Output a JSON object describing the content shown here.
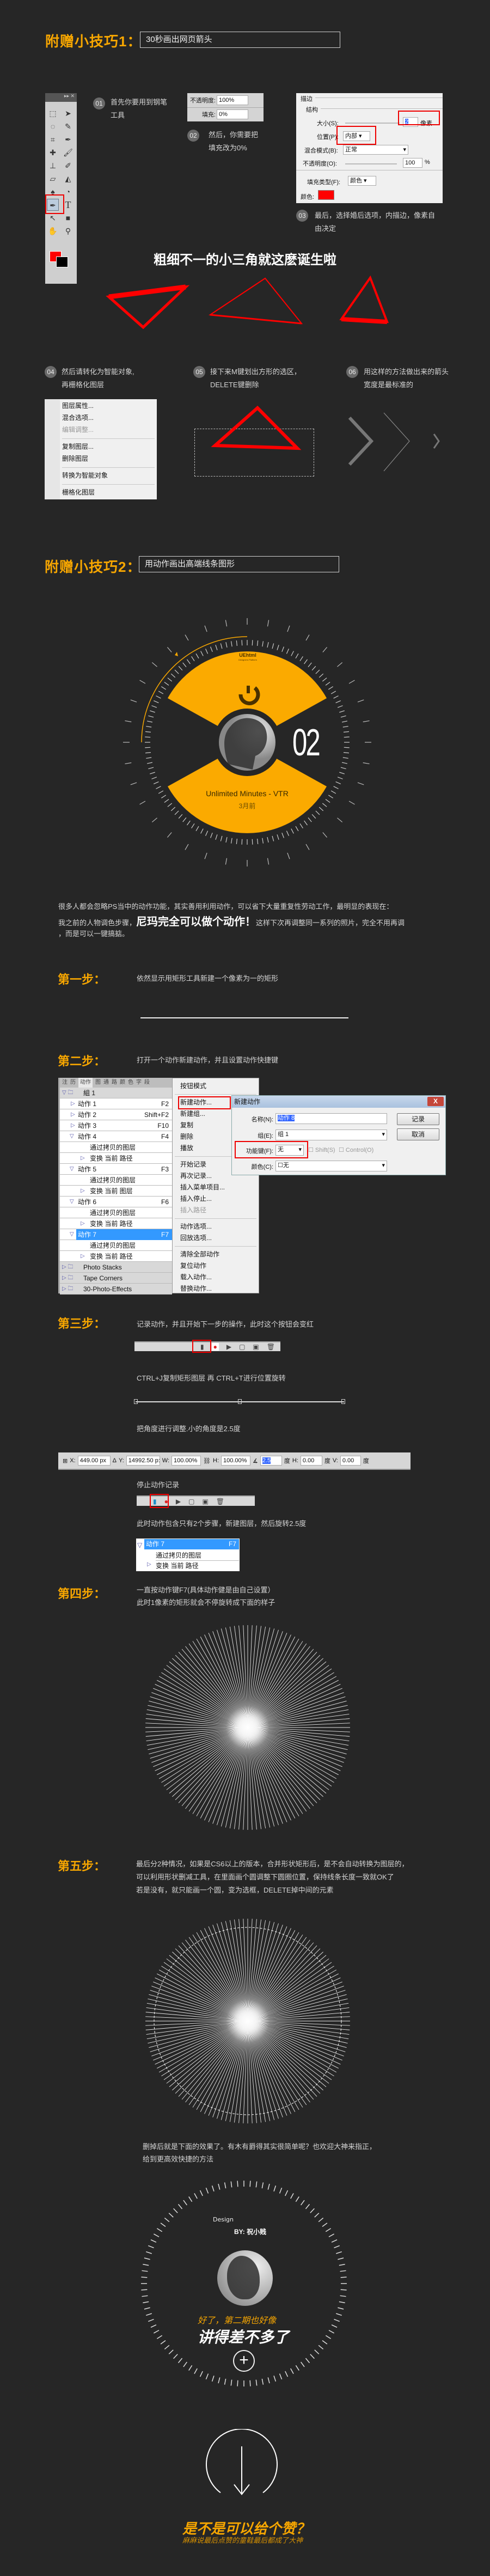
{
  "tip1": {
    "label": "附赠小技巧1：",
    "title": "30秒画出网页箭头"
  },
  "steps_a": [
    {
      "num": "01",
      "line1": "首先你要用到钢笔",
      "line2": "工具"
    },
    {
      "num": "02",
      "line1": "然后，你需要把",
      "line2": "填充改为0%"
    },
    {
      "num": "03",
      "line1": "最后，选择婚后选项，内描边，像素自",
      "line2": "由决定"
    }
  ],
  "fill_panel": {
    "opacity_label": "不透明度:",
    "opacity_value": "100%",
    "fill_label": "填充:",
    "fill_value": "0%"
  },
  "stroke_panel": {
    "title": "描边",
    "structure": "结构",
    "size_label": "大小(S):",
    "size_value": "2",
    "size_unit": "像素",
    "position_label": "位置(P):",
    "position_value": "内部",
    "blend_label": "混合模式(B):",
    "blend_value": "正常",
    "opacity_label": "不透明度(O):",
    "opacity_value": "100",
    "opacity_unit": "%",
    "fill_type_label": "填充类型(F):",
    "fill_type_value": "颜色",
    "color_label": "颜色:",
    "color_value": "#ff0000"
  },
  "heading1": "粗细不一的小三角就这麽诞生啦",
  "steps_b": [
    {
      "num": "04",
      "line1": "然后请转化为智能对象,",
      "line2": "再栅格化图层"
    },
    {
      "num": "05",
      "line1": "接下来M键划出方形的选区，",
      "line2": "DELETE键删除"
    },
    {
      "num": "06",
      "line1": "用这样的方法做出来的箭头",
      "line2": "宽度是最标准的"
    }
  ],
  "layer_menu": {
    "items": [
      "图层属性...",
      "混合选项...",
      "编辑调整...",
      "复制图层...",
      "删除图层",
      "转换为智能对象",
      "栅格化图层"
    ]
  },
  "tip2": {
    "label": "附赠小技巧2：",
    "title": "用动作画出高端线条图形"
  },
  "card": {
    "logo": "UEhtml",
    "logo_sub": "Designers Platform",
    "number": "02",
    "title": "Unlimited Minutes  - VTR",
    "time": "3月前",
    "accent": "#fbaa00"
  },
  "intro": {
    "line1": "很多人都会忽略PS当中的动作功能，其实善用利用动作，可以省下大量重复性劳动工作，最明显的表现在：",
    "line2a": "我之前的人物调色步骤，",
    "line2b": "尼玛完全可以做个动作！",
    "line2c": "这样下次再调整同一系列的照片，完全不用再调",
    "line3": "，而是可以一键搞掂。"
  },
  "step1": {
    "label": "第一步：",
    "text": "依然显示用矩形工具新建一个像素为一的矩形"
  },
  "step2": {
    "label": "第二步：",
    "text": "打开一个动作新建动作，并且设置动作快捷键"
  },
  "actions_panel": {
    "tabs": [
      "注",
      "历",
      "动作",
      "图",
      "通",
      "路",
      "颜",
      "色",
      "字",
      "段"
    ],
    "rows": [
      {
        "label": "組 1",
        "key": "",
        "type": "group-open"
      },
      {
        "label": "动作 1",
        "key": "F2",
        "type": "action"
      },
      {
        "label": "动作 2",
        "key": "Shift+F2",
        "type": "action"
      },
      {
        "label": "动作 3",
        "key": "F10",
        "type": "action"
      },
      {
        "label": "动作 4",
        "key": "F4",
        "type": "action-open"
      },
      {
        "label": "通过拷贝的图层",
        "key": "",
        "type": "cmd"
      },
      {
        "label": "变换 当前 路径",
        "key": "",
        "type": "cmd-arrow"
      },
      {
        "label": "动作 5",
        "key": "F3",
        "type": "action-open"
      },
      {
        "label": "通过拷贝的图层",
        "key": "",
        "type": "cmd"
      },
      {
        "label": "变换 当前 图层",
        "key": "",
        "type": "cmd-arrow"
      },
      {
        "label": "动作 6",
        "key": "F6",
        "type": "action-open"
      },
      {
        "label": "通过拷贝的图层",
        "key": "",
        "type": "cmd"
      },
      {
        "label": "变换 当前 路径",
        "key": "",
        "type": "cmd-arrow"
      },
      {
        "label": "动作 7",
        "key": "F7",
        "type": "action-selected"
      },
      {
        "label": "通过拷贝的图层",
        "key": "",
        "type": "cmd"
      },
      {
        "label": "变换 当前 路径",
        "key": "",
        "type": "cmd-arrow"
      },
      {
        "label": "Photo Stacks",
        "key": "",
        "type": "group"
      },
      {
        "label": "Tape Corners",
        "key": "",
        "type": "group"
      },
      {
        "label": "30-Photo-Effects",
        "key": "",
        "type": "group"
      }
    ]
  },
  "flyout": {
    "groups": [
      [
        "按钮模式"
      ],
      [
        "新建动作...",
        "新建组...",
        "复制",
        "删除",
        "播放"
      ],
      [
        "开始记录",
        "再次记录...",
        "插入菜单项目...",
        "插入停止...",
        "插入路径"
      ],
      [
        "动作选项...",
        "回放选项..."
      ],
      [
        "清除全部动作",
        "复位动作",
        "载入动作...",
        "替换动作..."
      ]
    ]
  },
  "dialog": {
    "title": "新建动作",
    "close": "X",
    "name_label": "名称(N):",
    "name_value": "动作 8",
    "group_label": "组(E):",
    "group_value": "组 1",
    "fkey_label": "功能键(F):",
    "fkey_value": "无",
    "shift_label": "Shift(S)",
    "control_label": "Control(O)",
    "color_label": "颜色(C):",
    "color_value": "无",
    "record": "记录",
    "cancel": "取消"
  },
  "step3": {
    "label": "第三步：",
    "text1": "记录动作，并且开始下一步的操作，此时这个按钮会变红",
    "text2": "CTRL+J复制矩形图层    再 CTRL+T进行位置旋转",
    "text3": "把角度进行调整.小的角度是2.5度",
    "text4": "停止动作记录",
    "text5": "此时动作包含只有2个步骤，新建图层，然后旋转2.5度"
  },
  "options_bar": {
    "x_label": "X:",
    "x_value": "449.00 px",
    "y_label": "Y:",
    "y_value": "14992.50 p:",
    "w_label": "W:",
    "w_value": "100.00%",
    "h_label": "H:",
    "h_value": "100.00%",
    "angle_value": "2.5",
    "deg": "度",
    "hskew_label": "H:",
    "hskew_value": "0.00",
    "vskew_label": "V:",
    "vskew_value": "0.00"
  },
  "mini_panel": {
    "action": "动作 7",
    "key": "F7",
    "cmd1": "通过拷贝的图层",
    "cmd2": "变换 当前 路径"
  },
  "step4": {
    "label": "第四步：",
    "text1": "一直按动作键F7(具体动作健是由自己设置）",
    "text2": "此时1像素的矩形就会不停旋转成下面的样子"
  },
  "step5": {
    "label": "第五步：",
    "text1": "最后分2种情况，如果是CS6以上的版本，合并形状矩形后，是不会自动转换为图层的，",
    "text2": "可以利用形状删减工具，在里面画个圆调整下圆圈位置，保持线条长度一致就OK了",
    "text3": "若是没有，就只能画一个圆，变为选框，DELETE掉中间的元素"
  },
  "outro": {
    "text1": "删掉后就是下面的效果了。有木有爵得其实很简单呢？也欢迎大神来指正，",
    "text2": "给到更高效快捷的方法"
  },
  "final_card": {
    "design": "Design",
    "by": "BY: 祝小贱",
    "line1": "好了，第二期也好像",
    "line2": "讲得差不多了"
  },
  "cta": {
    "title": "是不是可以给个赞？",
    "subtitle": "麻麻说最后点赞的童鞋最后都成了大神"
  }
}
